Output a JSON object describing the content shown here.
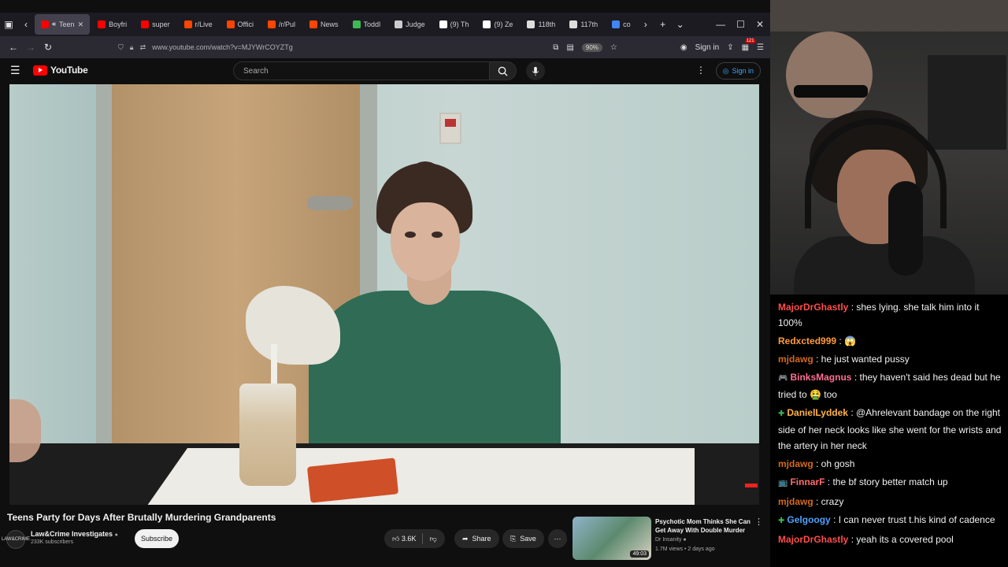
{
  "browser": {
    "tabs": [
      {
        "label": "Teen",
        "color": "#ff0000",
        "active": true
      },
      {
        "label": "Boyfri",
        "color": "#ff0000"
      },
      {
        "label": "super",
        "color": "#ff0000"
      },
      {
        "label": "r/Live",
        "color": "#ff4500"
      },
      {
        "label": "Offici",
        "color": "#ff4500"
      },
      {
        "label": "/r/Pul",
        "color": "#ff4500"
      },
      {
        "label": "News",
        "color": "#ff4500"
      },
      {
        "label": "Toddl",
        "color": "#3cba54"
      },
      {
        "label": "Judge",
        "color": "#cccccc"
      },
      {
        "label": "(9) Th",
        "color": "#ffffff"
      },
      {
        "label": "(9) Ze",
        "color": "#ffffff"
      },
      {
        "label": "118th",
        "color": "#dddddd"
      },
      {
        "label": "117th",
        "color": "#dddddd"
      },
      {
        "label": "co",
        "color": "#4285f4"
      }
    ],
    "url": "www.youtube.com/watch?v=MJYWrCOYZTg",
    "zoom": "90%",
    "sign_in": "Sign in",
    "notification_count": "121"
  },
  "youtube": {
    "logo_text": "YouTube",
    "search_placeholder": "Search",
    "sign_in": "Sign in"
  },
  "video": {
    "title": "Teens Party for Days After Brutally Murdering Grandparents",
    "channel_name": "Law&Crime Investigates",
    "channel_avatar_text": "LAW&CRIME",
    "subscribers": "233K subscribers",
    "subscribe_label": "Subscribe",
    "likes": "3.6K",
    "share_label": "Share",
    "save_label": "Save"
  },
  "recommendation": {
    "title": "Psychotic Mom Thinks She Can Get Away With Double Murder",
    "channel": "Dr Insanity",
    "meta": "1.7M views • 2 days ago",
    "duration": "49:03"
  },
  "chat": [
    {
      "user": "MajorDrGhastly",
      "color": "#ff4d4d",
      "badge": "",
      "text": ": shes lying. she talk him into it 100%"
    },
    {
      "user": "Redxcted999",
      "color": "#ff9a3c",
      "badge": "",
      "text": ": 😱"
    },
    {
      "user": "mjdawg",
      "color": "#d2691e",
      "badge": "",
      "text": ": he just wanted pussy"
    },
    {
      "user": "BinksMagnus",
      "color": "#ff6f91",
      "badge": "🎮",
      "text": ": they haven't said hes dead but he tried to 🤮 too"
    },
    {
      "user": "DanielLyddek",
      "color": "#ffb347",
      "badge": "✚",
      "text": ": @Ahrelevant bandage on the right side of her neck looks like she went for the wrists and the artery in her neck"
    },
    {
      "user": "mjdawg",
      "color": "#d2691e",
      "badge": "",
      "text": ": oh gosh"
    },
    {
      "user": "FinnarF",
      "color": "#ff6b6b",
      "badge": "📺",
      "text": ": the bf story better match up"
    },
    {
      "user": "mjdawg",
      "color": "#d2691e",
      "badge": "",
      "text": ": crazy"
    },
    {
      "user": "Gelgoogy",
      "color": "#4fa3ff",
      "badge": "✚",
      "text": ": I can never trust t.his kind of cadence"
    },
    {
      "user": "MajorDrGhastly",
      "color": "#ff4d4d",
      "badge": "",
      "text": ": yeah its a covered pool"
    }
  ]
}
